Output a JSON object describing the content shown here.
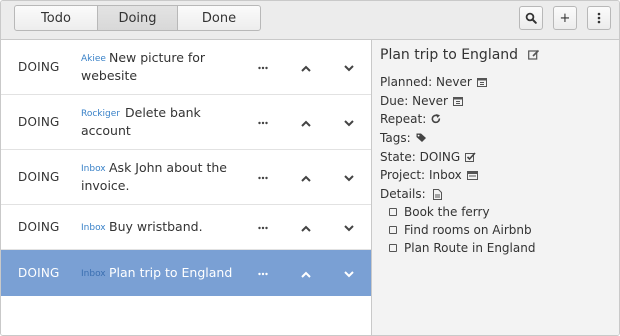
{
  "tabs": {
    "todo": "Todo",
    "doing": "Doing",
    "done": "Done"
  },
  "toolbar": {
    "search_icon": "search-icon",
    "add_label": "+",
    "menu_icon": "vertical-ellipsis-icon"
  },
  "tasks": [
    {
      "state": "DOING",
      "project": "Akiee",
      "title_line1": "New picture for",
      "title_line2": "webesite"
    },
    {
      "state": "DOING",
      "project": "Rockiger",
      "title_line1": "Delete bank",
      "title_line2": "account"
    },
    {
      "state": "DOING",
      "project": "Inbox",
      "title_line1": "Ask John about the",
      "title_line2": "invoice."
    },
    {
      "state": "DOING",
      "project": "Inbox",
      "title_line1": "Buy wristband.",
      "title_line2": ""
    },
    {
      "state": "DOING",
      "project": "Inbox",
      "title_line1": "Plan trip to England",
      "title_line2": ""
    }
  ],
  "row_icons": [
    "more-icon",
    "chevron-up-icon",
    "chevron-down-icon"
  ],
  "detail": {
    "title": "Plan trip to England",
    "planned_label": "Planned:",
    "planned_value": "Never",
    "due_label": "Due:",
    "due_value": "Never",
    "repeat_label": "Repeat:",
    "tags_label": "Tags:",
    "state_label": "State:",
    "state_value": "DOING",
    "project_label": "Project:",
    "project_value": "Inbox",
    "details_label": "Details:",
    "checklist": [
      "Book the ferry",
      "Find rooms on Airbnb",
      "Plan Route in England"
    ]
  },
  "colors": {
    "selected_row": "#7aa0d4",
    "project_tag": "#3a82c8",
    "detail_bg": "#f3f3f3",
    "toolbar_bg": "#ececec"
  }
}
